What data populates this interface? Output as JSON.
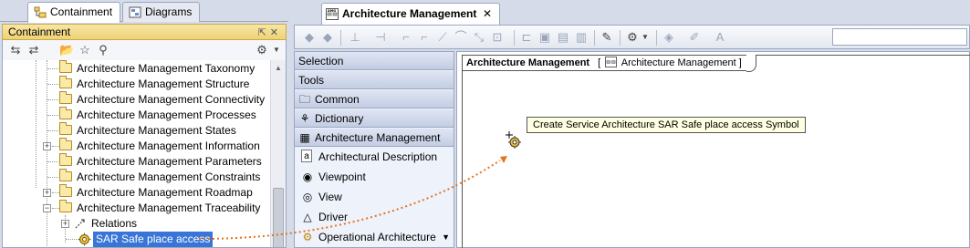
{
  "left_tabs": [
    "Containment",
    "Diagrams"
  ],
  "panel_title": "Containment",
  "tree": [
    {
      "label": "Architecture Management Taxonomy",
      "expandable": false
    },
    {
      "label": "Architecture Management Structure",
      "expandable": false
    },
    {
      "label": "Architecture Management Connectivity",
      "expandable": false
    },
    {
      "label": "Architecture Management Processes",
      "expandable": false
    },
    {
      "label": "Architecture Management States",
      "expandable": false
    },
    {
      "label": "Architecture Management Information",
      "expandable": true
    },
    {
      "label": "Architecture Management Parameters",
      "expandable": false
    },
    {
      "label": "Architecture Management Constraints",
      "expandable": false
    },
    {
      "label": "Architecture Management Roadmap",
      "expandable": true
    },
    {
      "label": "Architecture Management Traceability",
      "expandable": true
    },
    {
      "label": "Relations",
      "expandable": true
    },
    {
      "label": "SAR Safe place access",
      "expandable": false,
      "selected": true
    }
  ],
  "diagram_tab": {
    "label": "Architecture Management",
    "close": "✕"
  },
  "palette": {
    "selection": "Selection",
    "tools": "Tools",
    "groups": [
      "Common",
      "Dictionary",
      "Architecture Management"
    ],
    "items": [
      {
        "label": "Architectural Description",
        "icon": "a"
      },
      {
        "label": "Viewpoint",
        "icon": "eye"
      },
      {
        "label": "View",
        "icon": "view"
      },
      {
        "label": "Driver",
        "icon": "driver"
      },
      {
        "label": "Operational Architecture",
        "icon": "gear",
        "dropdown": true
      }
    ]
  },
  "frame": {
    "title": "Architecture Management",
    "bracket_open": "[",
    "bracket_text": "Architecture Management",
    "bracket_close": "]"
  },
  "tooltip": "Create Service Architecture SAR Safe place access Symbol",
  "colors": {
    "selection": "#3875d7",
    "arrow": "#e8731e",
    "header": "#efd275"
  }
}
